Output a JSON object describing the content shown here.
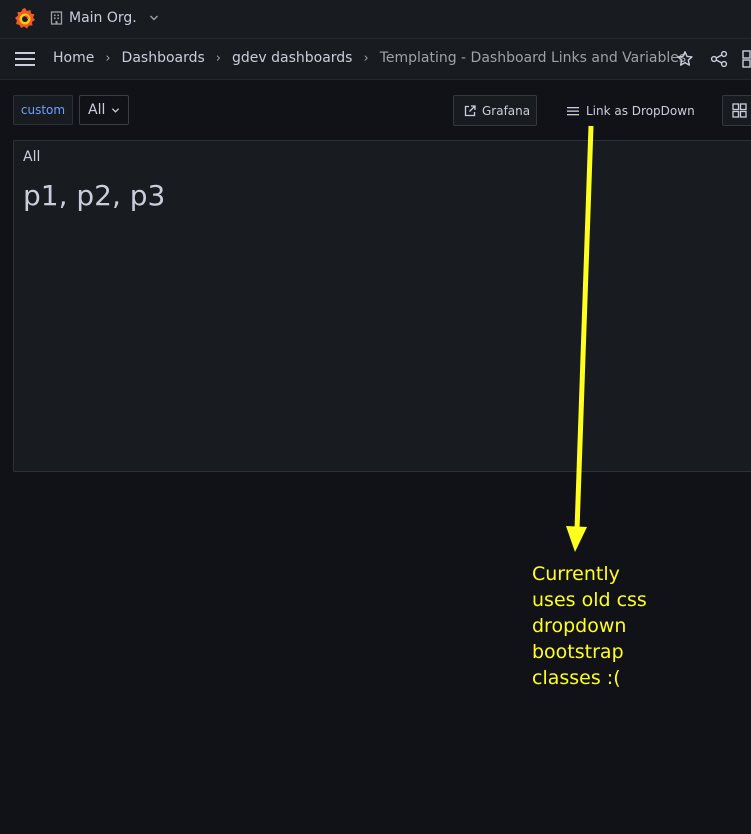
{
  "topbar": {
    "org_name": "Main Org."
  },
  "breadcrumb": [
    {
      "label": "Home"
    },
    {
      "label": "Dashboards"
    },
    {
      "label": "gdev dashboards"
    },
    {
      "label": "Templating - Dashboard Links and Variables"
    }
  ],
  "variables": {
    "label": "custom",
    "value": "All"
  },
  "dashboard_links": {
    "grafana_label": "Grafana",
    "dropdown_label": "Link as DropDown"
  },
  "panel": {
    "title": "All",
    "value": "p1, p2, p3"
  },
  "annotation": {
    "lines": [
      "Currently",
      "uses old css",
      "dropdown",
      "bootstrap",
      "classes :("
    ],
    "color": "#ffff1f"
  },
  "colors": {
    "accent": "#6e9fff",
    "logo": "#f05a28"
  }
}
